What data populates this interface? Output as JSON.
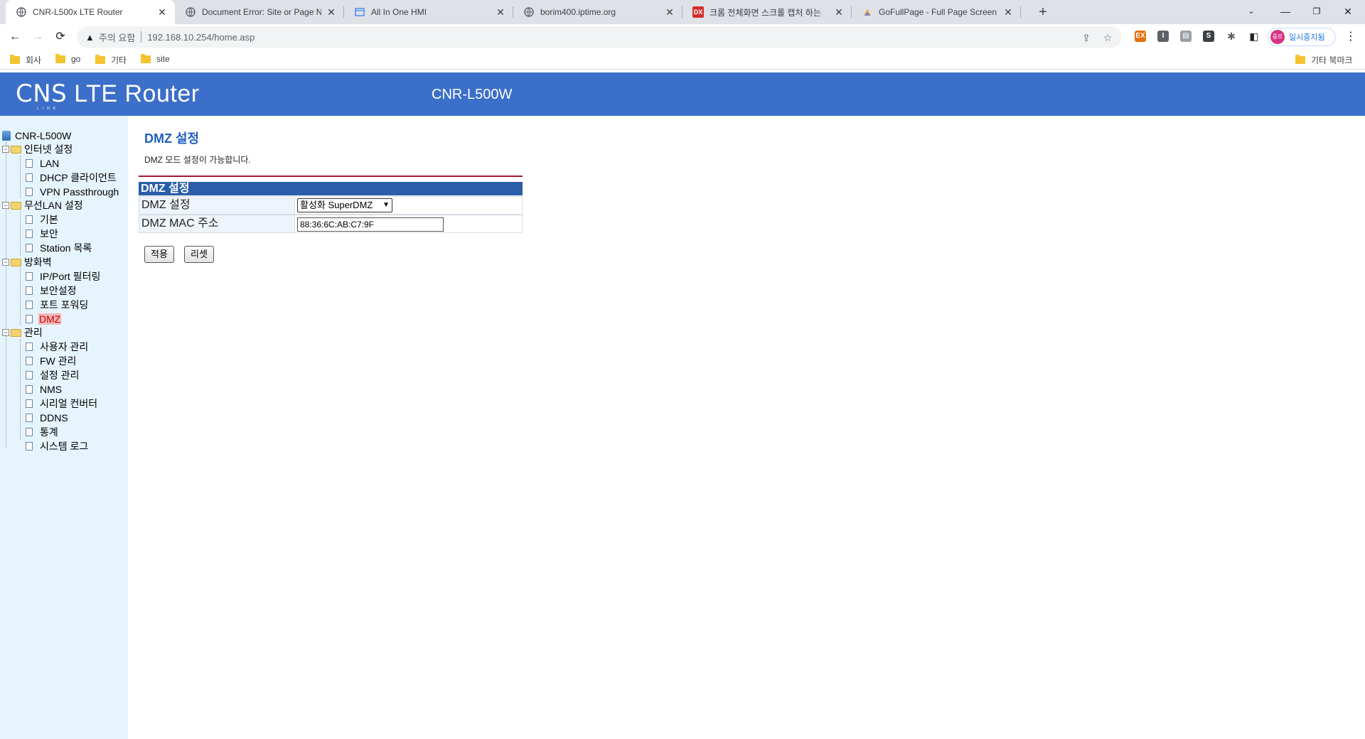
{
  "browser": {
    "tabs": [
      {
        "title": "CNR-L500x LTE Router",
        "active": true,
        "icon": "globe-icon"
      },
      {
        "title": "Document Error: Site or Page N",
        "active": false,
        "icon": "globe-icon"
      },
      {
        "title": "All In One HMI",
        "active": false,
        "icon": "page-icon"
      },
      {
        "title": "borim400.iptime.org",
        "active": false,
        "icon": "globe-icon"
      },
      {
        "title": "크롬 전체화면 스크롤 캡처 하는",
        "active": false,
        "icon": "dx-icon"
      },
      {
        "title": "GoFullPage - Full Page Screen C",
        "active": false,
        "icon": "gofullpage-icon"
      }
    ],
    "security_warning": "주의 요함",
    "url": "192.168.10.254/home.asp",
    "profile_label": "일시중지됨",
    "profile_avatar": "중로",
    "bookmarks": [
      "회사",
      "go",
      "기타",
      "site"
    ],
    "other_bookmarks": "기타 북마크"
  },
  "router": {
    "logo_main": "CNS",
    "logo_sub": "LINK",
    "logo_text": "LTE Router",
    "model": "CNR-L500W",
    "tree": {
      "root": "CNR-L500W",
      "internet": {
        "label": "인터넷 설정",
        "items": [
          "LAN",
          "DHCP 클라이언트",
          "VPN Passthrough"
        ]
      },
      "wlan": {
        "label": "무선LAN 설정",
        "items": [
          "기본",
          "보안",
          "Station 목록"
        ]
      },
      "firewall": {
        "label": "방화벽",
        "items": [
          "IP/Port 필터링",
          "보안설정",
          "포트 포워딩",
          "DMZ"
        ]
      },
      "admin": {
        "label": "관리",
        "items": [
          "사용자 관리",
          "FW 관리",
          "설정 관리",
          "NMS",
          "시리얼 컨버터",
          "DDNS",
          "통계",
          "시스템 로그"
        ]
      }
    },
    "page_title": "DMZ 설정",
    "page_desc": "DMZ 모드 설정이 가능합니다.",
    "table_header": "DMZ 설정",
    "row_dmz_label": "DMZ 설정",
    "row_dmz_value": "활성화 SuperDMZ",
    "row_mac_label": "DMZ MAC 주소",
    "row_mac_value": "88:36:6C:AB:C7:9F",
    "apply_label": "적용",
    "reset_label": "리셋"
  },
  "colors": {
    "banner": "#3b6fc9",
    "sidebar": "#e6f4fd",
    "title": "#1f5fbf",
    "table_header": "#2a5ea8",
    "rule": "#9e1b32"
  }
}
